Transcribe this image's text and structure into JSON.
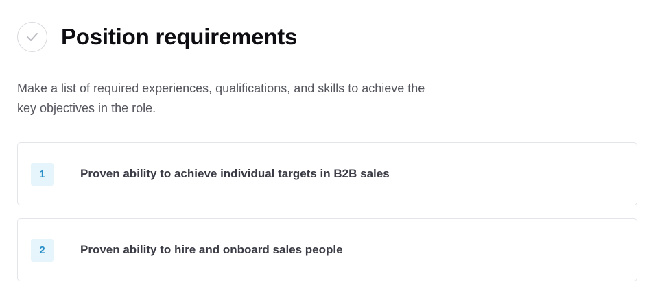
{
  "header": {
    "icon": "check-icon",
    "title": "Position requirements"
  },
  "description": "Make a list of required experiences, qualifications, and skills to achieve the key objectives in the role.",
  "requirements": [
    {
      "number": "1",
      "text": "Proven ability to achieve individual targets in B2B sales"
    },
    {
      "number": "2",
      "text": "Proven ability to hire and onboard sales people"
    }
  ],
  "colors": {
    "badge_bg": "#e6f4fb",
    "badge_text": "#2b8fc7",
    "border": "#e4e5ea"
  }
}
